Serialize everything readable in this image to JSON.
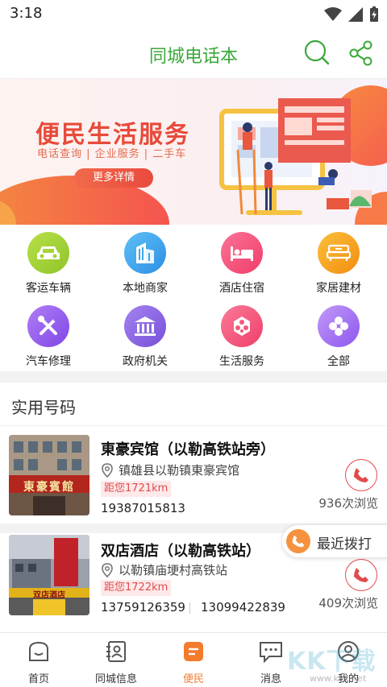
{
  "status_bar": {
    "time": "3:18"
  },
  "header": {
    "title": "同城电话本"
  },
  "banner": {
    "headline": "便民生活服务",
    "subtitle": "电话查询 | 企业服务 | 二手车",
    "button_label": "更多详情"
  },
  "categories": [
    {
      "label": "客运车辆",
      "icon": "car-icon",
      "color": "#a7d437"
    },
    {
      "label": "本地商家",
      "icon": "building-icon",
      "color": "#3aa8ee"
    },
    {
      "label": "酒店住宿",
      "icon": "bed-icon",
      "color": "#f6507c"
    },
    {
      "label": "家居建材",
      "icon": "sofa-icon",
      "color": "#f7a524"
    },
    {
      "label": "汽车修理",
      "icon": "tools-icon",
      "color": "#9a5ef0"
    },
    {
      "label": "政府机关",
      "icon": "government-icon",
      "color": "#8e62e6"
    },
    {
      "label": "生活服务",
      "icon": "service-icon",
      "color": "#f4567a"
    },
    {
      "label": "全部",
      "icon": "all-icon",
      "color": "#a06ef2"
    }
  ],
  "section": {
    "title": "实用号码"
  },
  "listings": [
    {
      "name": "東豪宾馆（以勒高铁站旁）",
      "address": "镇雄县以勒镇東豪宾馆",
      "distance": "距您1721km",
      "phones": [
        "19387015813"
      ],
      "views": "936次浏览",
      "sign_text": "東豪賓館"
    },
    {
      "name": "双店酒店（以勒高铁站）",
      "address": "以勒镇庙埂村高铁站",
      "distance": "距您1722km",
      "phones": [
        "13759126359",
        "13099422839"
      ],
      "views": "409次浏览",
      "sign_text": "双店酒店"
    }
  ],
  "floating": {
    "recent_label": "最近拨打"
  },
  "nav": {
    "tabs": [
      {
        "label": "首页",
        "icon": "home-icon"
      },
      {
        "label": "同城信息",
        "icon": "contacts-icon"
      },
      {
        "label": "便民",
        "icon": "service-doc-icon",
        "active": true
      },
      {
        "label": "消息",
        "icon": "message-icon"
      },
      {
        "label": "我的",
        "icon": "profile-icon"
      }
    ]
  },
  "watermark": {
    "text": "KK下载",
    "url": "www.kkx.net"
  },
  "colors": {
    "brand_green": "#3aa83a",
    "accent_orange": "#f37b2d",
    "call_red": "#e24a4a"
  }
}
